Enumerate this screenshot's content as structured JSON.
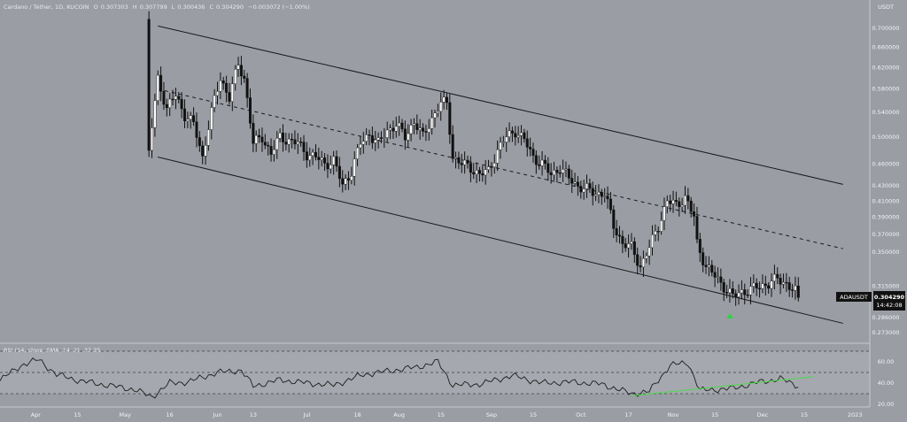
{
  "header": {
    "symbol": "Cardano / Tether, 1D, KUCOIN",
    "open_label": "O",
    "open_value": "0.307303",
    "high_label": "H",
    "high_value": "0.307799",
    "low_label": "L",
    "low_value": "0.300436",
    "close_label": "C",
    "close_value": "0.304290",
    "change_text": "−0.003072 (−1.00%)"
  },
  "colors": {
    "background": "#9a9da4",
    "up_candle": "#ffffff",
    "down_candle": "#111111",
    "channel_line": "#1a1a1a",
    "rsi_line": "#1c1c1c",
    "rsi_trendline": "#4cd94c",
    "marker": "#34d046",
    "badge_bg": "#111111"
  },
  "price_badge": {
    "ticker": "ADAUSDT",
    "price": "0.304290",
    "countdown": "14:42:08"
  },
  "chart_data": [
    {
      "type": "candlestick",
      "title": "Cardano / Tether, 1D, KUCOIN",
      "unit_label": "USDT",
      "y_scale": "log",
      "ylim": [
        0.26,
        0.74
      ],
      "y_ticks": [
        "0.700000",
        "0.660000",
        "0.620000",
        "0.580000",
        "0.540000",
        "0.500000",
        "0.460000",
        "0.430000",
        "0.410000",
        "0.390000",
        "0.370000",
        "0.350000",
        "0.315000",
        "0.286000",
        "0.273000"
      ],
      "x_ticks": [
        "Apr",
        "15",
        "May",
        "16",
        "Jun",
        "13",
        "Jul",
        "18",
        "Aug",
        "15",
        "Sep",
        "15",
        "Oct",
        "17",
        "Nov",
        "15",
        "Dec",
        "15",
        "2023"
      ],
      "last_price": 0.30429,
      "channel": {
        "upper": [
          {
            "date": "2022-05-12",
            "price": 0.705
          },
          {
            "date": "2022-12-28",
            "price": 0.432
          }
        ],
        "middle": [
          {
            "date": "2022-05-12",
            "price": 0.58
          },
          {
            "date": "2022-12-28",
            "price": 0.354
          }
        ],
        "lower": [
          {
            "date": "2022-05-12",
            "price": 0.47
          },
          {
            "date": "2022-12-28",
            "price": 0.281
          }
        ]
      },
      "marker": {
        "date": "2022-11-22",
        "price": 0.283,
        "shape": "up-arrow"
      },
      "closes": [
        {
          "date": "2022-05-09",
          "value": 0.475
        },
        {
          "date": "2022-05-12",
          "value": 0.6
        },
        {
          "date": "2022-05-15",
          "value": 0.545
        },
        {
          "date": "2022-05-18",
          "value": 0.57
        },
        {
          "date": "2022-05-21",
          "value": 0.535
        },
        {
          "date": "2022-05-24",
          "value": 0.52
        },
        {
          "date": "2022-05-27",
          "value": 0.47
        },
        {
          "date": "2022-05-30",
          "value": 0.54
        },
        {
          "date": "2022-06-02",
          "value": 0.6
        },
        {
          "date": "2022-06-05",
          "value": 0.565
        },
        {
          "date": "2022-06-08",
          "value": 0.625
        },
        {
          "date": "2022-06-10",
          "value": 0.6
        },
        {
          "date": "2022-06-13",
          "value": 0.49
        },
        {
          "date": "2022-06-16",
          "value": 0.5
        },
        {
          "date": "2022-06-19",
          "value": 0.475
        },
        {
          "date": "2022-06-22",
          "value": 0.5
        },
        {
          "date": "2022-06-25",
          "value": 0.495
        },
        {
          "date": "2022-06-28",
          "value": 0.49
        },
        {
          "date": "2022-07-01",
          "value": 0.475
        },
        {
          "date": "2022-07-04",
          "value": 0.47
        },
        {
          "date": "2022-07-07",
          "value": 0.46
        },
        {
          "date": "2022-07-10",
          "value": 0.465
        },
        {
          "date": "2022-07-13",
          "value": 0.43
        },
        {
          "date": "2022-07-16",
          "value": 0.45
        },
        {
          "date": "2022-07-19",
          "value": 0.49
        },
        {
          "date": "2022-07-22",
          "value": 0.505
        },
        {
          "date": "2022-07-25",
          "value": 0.49
        },
        {
          "date": "2022-07-28",
          "value": 0.51
        },
        {
          "date": "2022-07-31",
          "value": 0.52
        },
        {
          "date": "2022-08-03",
          "value": 0.5
        },
        {
          "date": "2022-08-06",
          "value": 0.525
        },
        {
          "date": "2022-08-09",
          "value": 0.5
        },
        {
          "date": "2022-08-12",
          "value": 0.53
        },
        {
          "date": "2022-08-15",
          "value": 0.555
        },
        {
          "date": "2022-08-17",
          "value": 0.555
        },
        {
          "date": "2022-08-19",
          "value": 0.47
        },
        {
          "date": "2022-08-22",
          "value": 0.46
        },
        {
          "date": "2022-08-25",
          "value": 0.455
        },
        {
          "date": "2022-08-28",
          "value": 0.445
        },
        {
          "date": "2022-08-31",
          "value": 0.45
        },
        {
          "date": "2022-09-03",
          "value": 0.48
        },
        {
          "date": "2022-09-06",
          "value": 0.5
        },
        {
          "date": "2022-09-09",
          "value": 0.51
        },
        {
          "date": "2022-09-12",
          "value": 0.495
        },
        {
          "date": "2022-09-15",
          "value": 0.47
        },
        {
          "date": "2022-09-18",
          "value": 0.46
        },
        {
          "date": "2022-09-21",
          "value": 0.445
        },
        {
          "date": "2022-09-24",
          "value": 0.455
        },
        {
          "date": "2022-09-27",
          "value": 0.44
        },
        {
          "date": "2022-09-30",
          "value": 0.43
        },
        {
          "date": "2022-10-03",
          "value": 0.425
        },
        {
          "date": "2022-10-06",
          "value": 0.42
        },
        {
          "date": "2022-10-09",
          "value": 0.42
        },
        {
          "date": "2022-10-12",
          "value": 0.38
        },
        {
          "date": "2022-10-15",
          "value": 0.36
        },
        {
          "date": "2022-10-18",
          "value": 0.355
        },
        {
          "date": "2022-10-21",
          "value": 0.335
        },
        {
          "date": "2022-10-24",
          "value": 0.355
        },
        {
          "date": "2022-10-27",
          "value": 0.38
        },
        {
          "date": "2022-10-30",
          "value": 0.41
        },
        {
          "date": "2022-11-02",
          "value": 0.405
        },
        {
          "date": "2022-11-05",
          "value": 0.415
        },
        {
          "date": "2022-11-08",
          "value": 0.39
        },
        {
          "date": "2022-11-09",
          "value": 0.36
        },
        {
          "date": "2022-11-12",
          "value": 0.335
        },
        {
          "date": "2022-11-15",
          "value": 0.325
        },
        {
          "date": "2022-11-18",
          "value": 0.315
        },
        {
          "date": "2022-11-21",
          "value": 0.305
        },
        {
          "date": "2022-11-24",
          "value": 0.31
        },
        {
          "date": "2022-11-27",
          "value": 0.312
        },
        {
          "date": "2022-11-30",
          "value": 0.315
        },
        {
          "date": "2022-12-03",
          "value": 0.318
        },
        {
          "date": "2022-12-06",
          "value": 0.322
        },
        {
          "date": "2022-12-09",
          "value": 0.318
        },
        {
          "date": "2022-12-12",
          "value": 0.31
        },
        {
          "date": "2022-12-13",
          "value": 0.30429
        }
      ]
    },
    {
      "type": "line",
      "title": "RSI (14, close, SMA, 14, 2)",
      "series": [
        {
          "name": "RSI",
          "values_by_date": [
            {
              "date": "2022-03-20",
              "value": 43
            },
            {
              "date": "2022-03-28",
              "value": 58
            },
            {
              "date": "2022-04-02",
              "value": 62
            },
            {
              "date": "2022-04-08",
              "value": 48
            },
            {
              "date": "2022-04-16",
              "value": 42
            },
            {
              "date": "2022-04-25",
              "value": 38
            },
            {
              "date": "2022-05-04",
              "value": 34
            },
            {
              "date": "2022-05-10",
              "value": 27
            },
            {
              "date": "2022-05-16",
              "value": 40
            },
            {
              "date": "2022-05-22",
              "value": 41
            },
            {
              "date": "2022-06-01",
              "value": 50
            },
            {
              "date": "2022-06-09",
              "value": 52
            },
            {
              "date": "2022-06-13",
              "value": 37
            },
            {
              "date": "2022-06-22",
              "value": 43
            },
            {
              "date": "2022-07-01",
              "value": 40
            },
            {
              "date": "2022-07-10",
              "value": 38
            },
            {
              "date": "2022-07-20",
              "value": 48
            },
            {
              "date": "2022-07-30",
              "value": 52
            },
            {
              "date": "2022-08-07",
              "value": 55
            },
            {
              "date": "2022-08-14",
              "value": 60
            },
            {
              "date": "2022-08-19",
              "value": 38
            },
            {
              "date": "2022-08-28",
              "value": 39
            },
            {
              "date": "2022-09-08",
              "value": 47
            },
            {
              "date": "2022-09-18",
              "value": 40
            },
            {
              "date": "2022-09-28",
              "value": 41
            },
            {
              "date": "2022-10-08",
              "value": 39
            },
            {
              "date": "2022-10-18",
              "value": 30
            },
            {
              "date": "2022-10-24",
              "value": 32
            },
            {
              "date": "2022-10-31",
              "value": 57
            },
            {
              "date": "2022-11-06",
              "value": 59
            },
            {
              "date": "2022-11-10",
              "value": 33
            },
            {
              "date": "2022-11-21",
              "value": 35
            },
            {
              "date": "2022-11-30",
              "value": 41
            },
            {
              "date": "2022-12-07",
              "value": 44
            },
            {
              "date": "2022-12-13",
              "value": 37.35
            }
          ]
        }
      ],
      "last_value": 37.35,
      "y_ticks": [
        "60.00",
        "40.00",
        "20.00"
      ],
      "ylim": [
        15,
        75
      ],
      "bands": [
        30,
        50,
        70
      ],
      "trendline": [
        {
          "date": "2022-10-18",
          "value": 28
        },
        {
          "date": "2022-12-18",
          "value": 46
        }
      ]
    }
  ]
}
